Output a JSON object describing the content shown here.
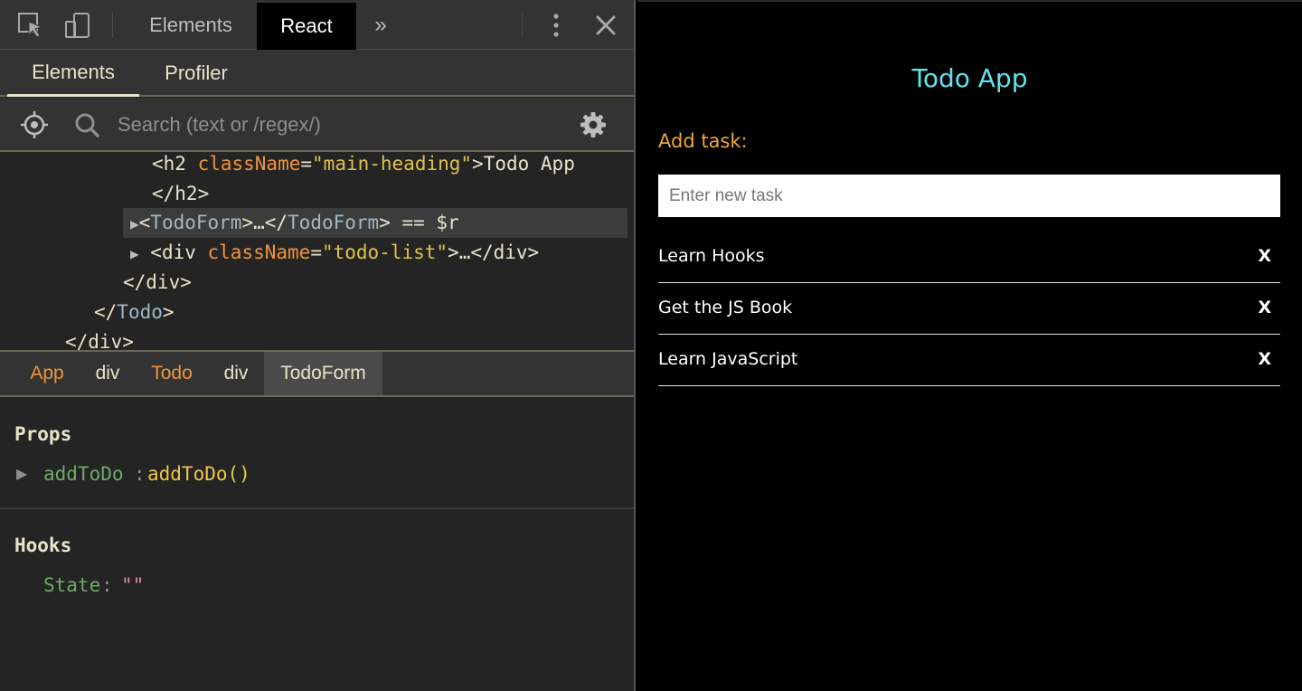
{
  "devtools": {
    "tabs": {
      "elements": "Elements",
      "react": "React",
      "overflow": "»"
    },
    "subtabs": {
      "elements": "Elements",
      "profiler": "Profiler"
    },
    "search": {
      "placeholder": "Search (text or /regex/)"
    },
    "tree": {
      "line1": {
        "open": "<h2 ",
        "attr": "className",
        "eq": "=",
        "val": "\"main-heading\"",
        "close": ">Todo App"
      },
      "line2": {
        "text": "</h2>"
      },
      "line3": {
        "arrow": "▶",
        "open": "<",
        "name": "TodoForm",
        "mid": ">…</",
        "name2": "TodoForm",
        "close": ">",
        "suffix": " == $r"
      },
      "line4": {
        "arrow": "▶",
        "open": "<div ",
        "attr": "className",
        "eq": "=",
        "val": "\"todo-list\"",
        "close": ">…</div>"
      },
      "line5": {
        "text": "</div>"
      },
      "line6": {
        "open": "</",
        "name": "Todo",
        "close": ">"
      },
      "line7": {
        "text": "</div>"
      }
    },
    "breadcrumbs": [
      {
        "label": "App",
        "color": "#f0943a"
      },
      {
        "label": "div",
        "color": "#e9e3c9"
      },
      {
        "label": "Todo",
        "color": "#f0943a"
      },
      {
        "label": "div",
        "color": "#e9e3c9"
      },
      {
        "label": "TodoForm",
        "color": "#e9e3c9",
        "selected": true
      }
    ],
    "props": {
      "title": "Props",
      "items": [
        {
          "key": "addToDo",
          "sep": ":",
          "value": "addToDo()"
        }
      ]
    },
    "hooks": {
      "title": "Hooks",
      "items": [
        {
          "key": "State",
          "sep": ":",
          "value": "\"\""
        }
      ]
    },
    "icons": [
      "inspect-icon",
      "device-toolbar-icon",
      "more-options-icon",
      "close-icon",
      "target-icon",
      "search-icon",
      "gear-icon"
    ]
  },
  "app": {
    "title": "Todo App",
    "add_label": "Add task:",
    "input_placeholder": "Enter new task",
    "todos": [
      {
        "text": "Learn Hooks",
        "delete": "X"
      },
      {
        "text": "Get the JS Book",
        "delete": "X"
      },
      {
        "text": "Learn JavaScript",
        "delete": "X"
      }
    ]
  },
  "colors": {
    "devtools_bg": "#242424",
    "toolbar_bg": "#333333",
    "app_bg": "#000000",
    "title": "#5ee4ee",
    "accent": "#f2a53a",
    "prop_key": "#6fa86b",
    "prop_value": "#f0c64a",
    "string_value": "#e08a9c"
  }
}
